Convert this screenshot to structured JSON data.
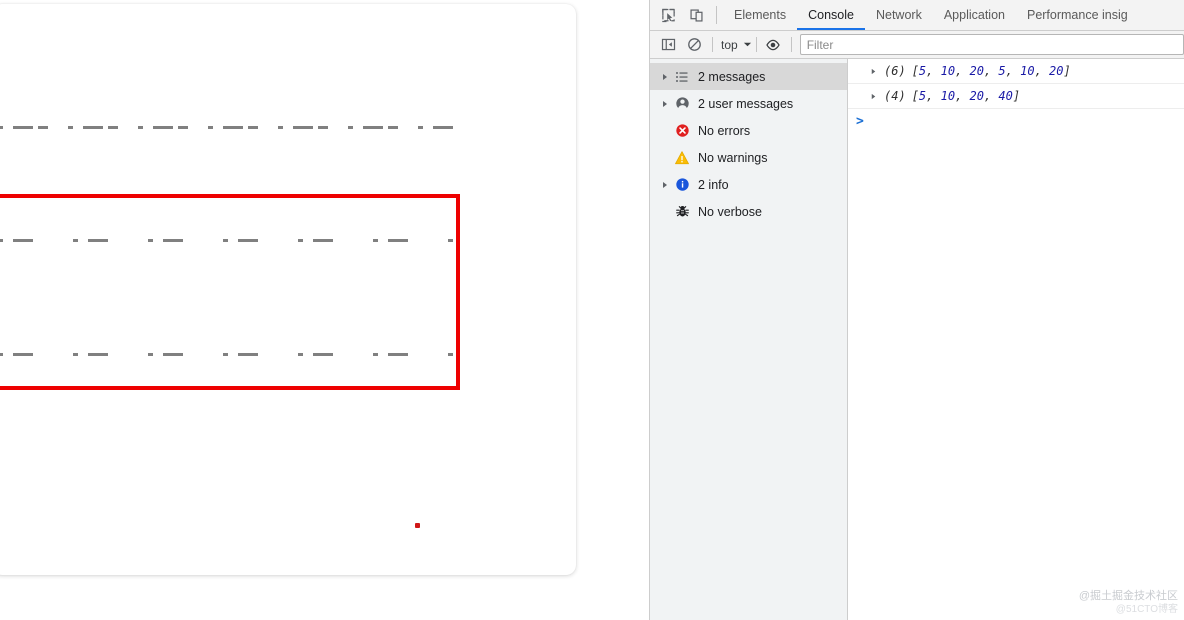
{
  "page": {
    "canvas": {
      "dash_rows": [
        {
          "name": "dash-line-top",
          "pattern": [
            5,
            10,
            20,
            5,
            10,
            20
          ],
          "color": "#808080",
          "line_width": 3
        },
        {
          "name": "dash-line-middle",
          "pattern": [
            5,
            10,
            20,
            40
          ],
          "color": "#808080",
          "line_width": 3
        },
        {
          "name": "dash-line-bottom",
          "pattern": [
            5,
            10,
            20,
            40
          ],
          "color": "#808080",
          "line_width": 3
        }
      ],
      "highlight_color": "#ee0000",
      "dot_color": "#d01818"
    }
  },
  "devtools": {
    "tabs": [
      {
        "label": "Elements",
        "active": false
      },
      {
        "label": "Console",
        "active": true
      },
      {
        "label": "Network",
        "active": false
      },
      {
        "label": "Application",
        "active": false
      },
      {
        "label": "Performance insig",
        "active": false
      }
    ],
    "toolbar_icons": [
      {
        "name": "inspect-element-icon"
      },
      {
        "name": "device-toolbar-icon"
      }
    ],
    "accent_color": "#1a73e8",
    "actionbar": {
      "sidebar_toggle_icon": "console-sidebar-toggle-icon",
      "clear_console_icon": "clear-console-icon",
      "context_value": "top",
      "eye_icon": "live-expression-eye-icon",
      "filter_placeholder": "Filter",
      "filter_value": ""
    },
    "sidebar": {
      "items": [
        {
          "label": "2 messages",
          "icon": "list-icon",
          "expandable": true,
          "selected": true
        },
        {
          "label": "2 user messages",
          "icon": "user-icon",
          "expandable": true,
          "selected": false
        },
        {
          "label": "No errors",
          "icon": "error-icon",
          "expandable": false,
          "selected": false
        },
        {
          "label": "No warnings",
          "icon": "warning-icon",
          "expandable": false,
          "selected": false
        },
        {
          "label": "2 info",
          "icon": "info-icon",
          "expandable": true,
          "selected": false
        },
        {
          "label": "No verbose",
          "icon": "verbose-bug-icon",
          "expandable": false,
          "selected": false
        }
      ]
    },
    "console": {
      "messages": [
        {
          "count": "(6)",
          "values": [
            5,
            10,
            20,
            5,
            10,
            20
          ]
        },
        {
          "count": "(4)",
          "values": [
            5,
            10,
            20,
            40
          ]
        }
      ],
      "prompt_symbol": ">"
    }
  },
  "watermark": {
    "line1": "@掘土掘金技术社区",
    "line2": "@51CTO博客"
  }
}
